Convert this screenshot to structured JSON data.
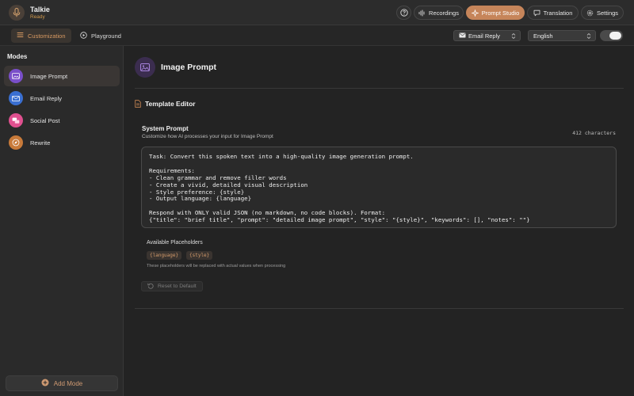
{
  "app": {
    "name": "Talkie",
    "status": "Ready"
  },
  "header": {
    "help_icon": "question-circle-icon",
    "buttons": [
      {
        "label": "Recordings",
        "icon": "waveform-icon",
        "active": false
      },
      {
        "label": "Prompt Studio",
        "icon": "sparkle-icon",
        "active": true
      },
      {
        "label": "Translation",
        "icon": "chat-bubble-icon",
        "active": false
      },
      {
        "label": "Settings",
        "icon": "gear-icon",
        "active": false
      }
    ]
  },
  "toolbar": {
    "tabs": [
      {
        "label": "Customization",
        "icon": "sliders-icon",
        "active": true
      },
      {
        "label": "Playground",
        "icon": "play-circle-icon",
        "active": false
      }
    ],
    "mode_select": {
      "value": "Email Reply",
      "icon": "envelope-icon"
    },
    "language_select": {
      "value": "English"
    },
    "toggle_on": true
  },
  "sidebar": {
    "heading": "Modes",
    "items": [
      {
        "label": "Image Prompt",
        "icon": "image-icon",
        "color": "#7a4fc9",
        "active": true
      },
      {
        "label": "Email Reply",
        "icon": "envelope-icon",
        "color": "#3a6fd1",
        "active": false
      },
      {
        "label": "Social Post",
        "icon": "chat-bubbles-icon",
        "color": "#e0508f",
        "active": false
      },
      {
        "label": "Rewrite",
        "icon": "compass-icon",
        "color": "#c87a3a",
        "active": false
      }
    ],
    "add_label": "Add Mode"
  },
  "main": {
    "mode_title": "Image Prompt",
    "section_title": "Template Editor",
    "system_prompt": {
      "title": "System Prompt",
      "subtitle": "Customize how AI processes your input for Image Prompt",
      "char_count": "412 characters",
      "text": "Task: Convert this spoken text into a high-quality image generation prompt.\n\nRequirements:\n- Clean grammar and remove filler words\n- Create a vivid, detailed visual description\n- Style preference: {style}\n- Output language: {language}\n\nRespond with ONLY valid JSON (no markdown, no code blocks). Format:\n{\"title\": \"brief title\", \"prompt\": \"detailed image prompt\", \"style\": \"{style}\", \"keywords\": [], \"notes\": \"\"}"
    },
    "placeholders": {
      "title": "Available Placeholders",
      "chips": [
        "{language}",
        "{style}"
      ],
      "note": "These placeholders will be replaced with actual values when processing"
    },
    "reset_label": "Reset to Default"
  },
  "colors": {
    "accent": "#c6855a",
    "accent_text": "#d89a62",
    "background": "#232323"
  }
}
